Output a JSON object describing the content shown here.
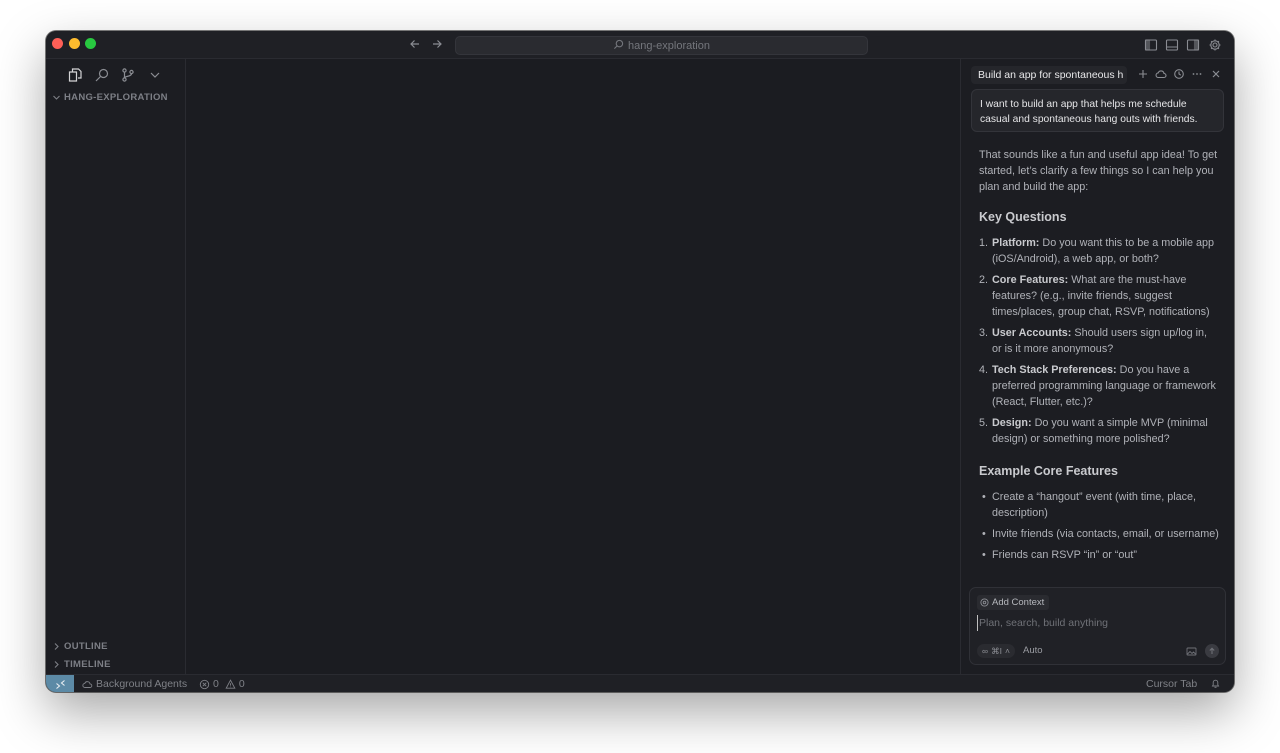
{
  "titlebar": {
    "search_text": "hang-exploration"
  },
  "sidebar": {
    "folder_name": "HANG-EXPLORATION",
    "outline_label": "OUTLINE",
    "timeline_label": "TIMELINE"
  },
  "chat": {
    "tab_title": "Build an app for spontaneous h",
    "user_message": "I want to build an app that helps me schedule casual and spontaneous hang outs with friends.",
    "intro": "That sounds like a fun and useful app idea! To get started, let’s clarify a few things so I can help you plan and build the app:",
    "key_questions_heading": "Key Questions",
    "questions": [
      {
        "num": "1.",
        "label": "Platform:",
        "text": " Do you want this to be a mobile app (iOS/Android), a web app, or both?"
      },
      {
        "num": "2.",
        "label": "Core Features:",
        "text": " What are the must-have features? (e.g., invite friends, suggest times/places, group chat, RSVP, notifications)"
      },
      {
        "num": "3.",
        "label": "User Accounts:",
        "text": " Should users sign up/log in, or is it more anonymous?"
      },
      {
        "num": "4.",
        "label": "Tech Stack Preferences:",
        "text": " Do you have a preferred programming language or framework (React, Flutter, etc.)?"
      },
      {
        "num": "5.",
        "label": "Design:",
        "text": " Do you want a simple MVP (minimal design) or something more polished?"
      }
    ],
    "features_heading": "Example Core Features",
    "features": [
      "Create a “hangout” event (with time, place, description)",
      "Invite friends (via contacts, email, or username)",
      "Friends can RSVP “in” or “out”"
    ],
    "composer": {
      "add_context_label": "Add Context",
      "placeholder": "Plan, search, build anything",
      "mode_shortcut": "⌘I",
      "model_label": "Auto"
    }
  },
  "statusbar": {
    "background_agents": "Background Agents",
    "errors": "0",
    "warnings": "0",
    "cursor_tab": "Cursor Tab"
  }
}
